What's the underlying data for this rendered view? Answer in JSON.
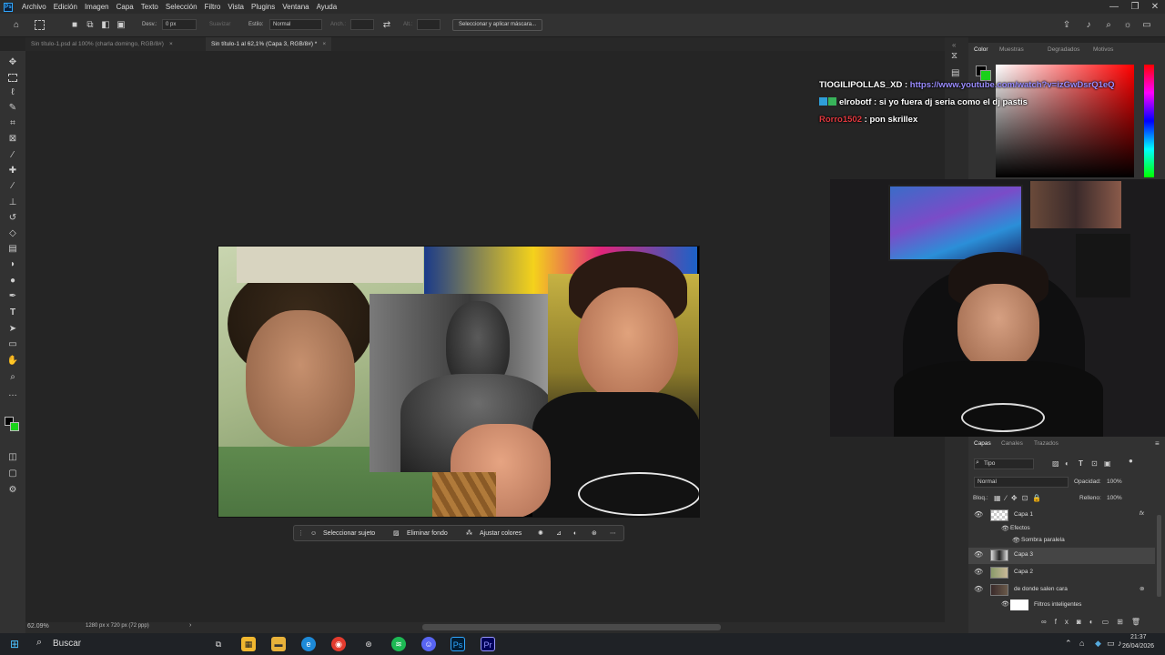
{
  "menubar": {
    "logo": "Ps",
    "items": [
      "Archivo",
      "Edición",
      "Imagen",
      "Capa",
      "Texto",
      "Selección",
      "Filtro",
      "Vista",
      "Plugins",
      "Ventana",
      "Ayuda"
    ],
    "window_controls": [
      "—",
      "❐",
      "✕"
    ]
  },
  "optionsbar": {
    "feather_label": "Desv.:",
    "feather_value": "0 px",
    "smooth_label": "Suavizar",
    "style_label": "Estilo:",
    "style_value": "Normal",
    "width_label": "Anch.:",
    "height_label": "Alt.:",
    "mask_button": "Seleccionar y aplicar máscara..."
  },
  "tabs": [
    {
      "label": "Sin título-1.psd al 100% (charla domingo, RGB/8#)",
      "active": false
    },
    {
      "label": "Sin título-1 al 62,1% (Capa 3, RGB/8#) *",
      "active": true
    }
  ],
  "status": {
    "zoom": "62.09%",
    "doc_size": "1280 px x 720 px (72 ppp)"
  },
  "context_bar": {
    "select_subject": "Seleccionar sujeto",
    "remove_bg": "Eliminar fondo",
    "adjust_colors": "Ajustar colores"
  },
  "color_panel": {
    "tabs": [
      "Color",
      "Muestras",
      "Degradados",
      "Motivos"
    ]
  },
  "chat": [
    {
      "user": "TIOGILIPOLLAS_XD",
      "user_color": "#ffffff",
      "sep": " : ",
      "message": "https://www.youtube.com/watch?v=izGwDsrQ1eQ",
      "msg_color": "#9a8cff"
    },
    {
      "user": "elrobotf",
      "user_color": "#ffffff",
      "sep": " : ",
      "message": "si yo fuera dj seria como el dj pastis",
      "msg_color": "#ffffff"
    },
    {
      "user": "Rorro1502",
      "user_color": "#e0383e",
      "sep": " : ",
      "message": "pon skrillex",
      "msg_color": "#ffffff"
    }
  ],
  "layers_panel": {
    "tabs": [
      "Capas",
      "Canales",
      "Trazados"
    ],
    "filter": "Tipo",
    "blend_mode": "Normal",
    "opacity_label": "Opacidad:",
    "opacity_value": "100%",
    "lock_label": "Bloq.:",
    "fill_label": "Relleno:",
    "fill_value": "100%",
    "layers": [
      {
        "name": "Capa 1",
        "fx": "fx"
      },
      {
        "name": "Efectos"
      },
      {
        "name": "Sombra paralela"
      },
      {
        "name": "Capa 3"
      },
      {
        "name": "Capa 2"
      },
      {
        "name": "de donde salen cara"
      },
      {
        "name": "Filtros inteligentes"
      }
    ]
  },
  "taskbar": {
    "search": "Buscar",
    "time": "21:37",
    "date": "26/04/2026"
  }
}
